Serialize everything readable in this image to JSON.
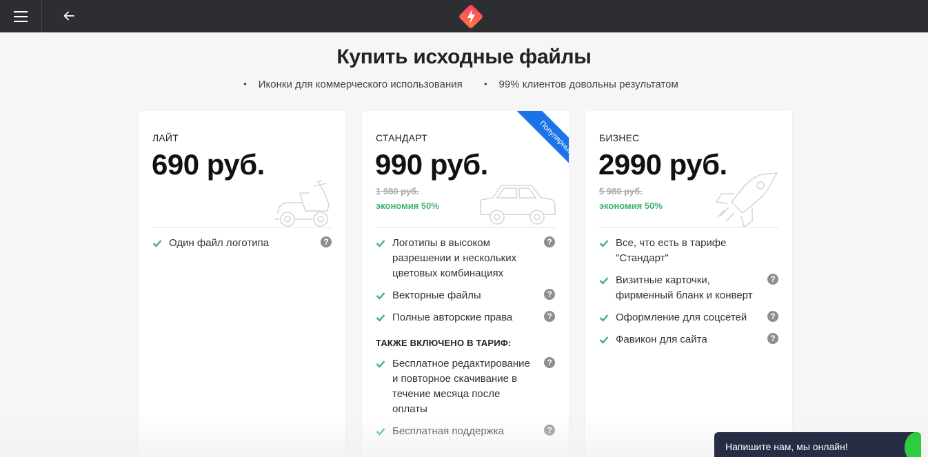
{
  "topbar": {
    "menu_icon": "hamburger-icon",
    "back_icon": "arrow-left-icon",
    "logo_icon": "brand-logo-icon"
  },
  "header": {
    "title": "Купить исходные файлы",
    "bullets": [
      "Иконки для коммерческого использования",
      "99% клиентов довольны результатом"
    ]
  },
  "plans": [
    {
      "name": "ЛАЙТ",
      "price": "690 руб.",
      "illustration": "scooter-icon",
      "features": [
        {
          "text": "Один файл логотипа"
        }
      ]
    },
    {
      "name": "СТАНДАРТ",
      "price": "990 руб.",
      "old_price": "1 980 руб.",
      "saving": "экономия 50%",
      "badge": "Популярный",
      "illustration": "car-icon",
      "features": [
        {
          "text": "Логотипы в высоком разрешении и нескольких цветовых комбинациях"
        },
        {
          "text": "Векторные файлы"
        },
        {
          "text": "Полные авторские права"
        }
      ],
      "also_title": "ТАКЖЕ ВКЛЮЧЕНО В ТАРИФ:",
      "also_features": [
        {
          "text": "Бесплатное редактирование и повторное скачивание в течение месяца после оплаты"
        },
        {
          "text": "Бесплатная поддержка"
        }
      ]
    },
    {
      "name": "БИЗНЕС",
      "price": "2990 руб.",
      "old_price": "5 980 руб.",
      "saving": "экономия 50%",
      "illustration": "rocket-icon",
      "features": [
        {
          "text": "Все, что есть в тарифе \"Стандарт\"",
          "help": false
        },
        {
          "text": "Визитные карточки, фирменный бланк и конверт"
        },
        {
          "text": "Оформление для соцсетей"
        },
        {
          "text": "Фавикон для сайта"
        }
      ]
    }
  ],
  "help_glyph": "?",
  "chat": {
    "label": "Напишите нам, мы онлайн!"
  },
  "colors": {
    "topbar": "#2c2e31",
    "accent_green": "#3cb46e",
    "ribbon": "#1a73e8",
    "chat": "#262d45"
  }
}
